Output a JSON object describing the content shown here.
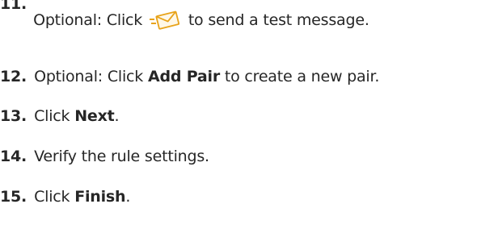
{
  "steps": [
    {
      "number": "11.",
      "before": "Optional: Click",
      "icon": "send-test-message-icon",
      "after": "to send a test message."
    },
    {
      "number": "12.",
      "before": "Optional: Click",
      "bold": "Add Pair",
      "after": "to create a new pair."
    },
    {
      "number": "13.",
      "before": "Click",
      "bold": "Next",
      "after": "."
    },
    {
      "number": "14.",
      "text": "Verify the rule settings."
    },
    {
      "number": "15.",
      "before": "Click",
      "bold": "Finish",
      "after": "."
    }
  ],
  "colors": {
    "text": "#262626",
    "icon_accent": "#e8a31a"
  }
}
